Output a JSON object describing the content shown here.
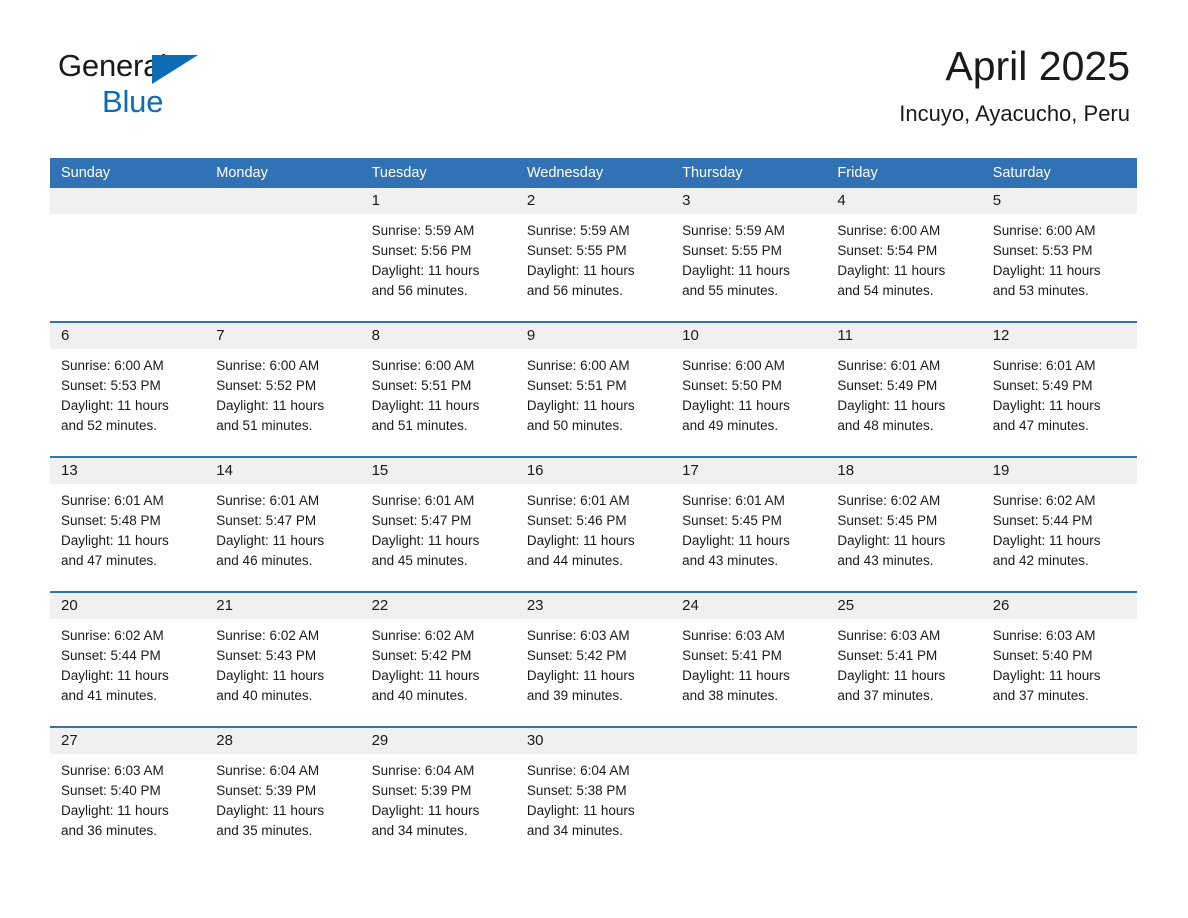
{
  "brand": {
    "name_part_1": "General",
    "name_part_2": "Blue",
    "triangle_color": "#0c6cb5"
  },
  "header": {
    "title": "April 2025",
    "subtitle": "Incuyo, Ayacucho, Peru",
    "accent_color": "#3172b5",
    "daynumber_band_color": "#f0f0f0"
  },
  "weekdays": [
    "Sunday",
    "Monday",
    "Tuesday",
    "Wednesday",
    "Thursday",
    "Friday",
    "Saturday"
  ],
  "weeks": [
    {
      "days": [
        {
          "num": "",
          "sunrise": "",
          "sunset": "",
          "daylight": "",
          "empty": true
        },
        {
          "num": "",
          "sunrise": "",
          "sunset": "",
          "daylight": "",
          "empty": true
        },
        {
          "num": "1",
          "sunrise": "Sunrise: 5:59 AM",
          "sunset": "Sunset: 5:56 PM",
          "daylight": "Daylight: 11 hours and 56 minutes.",
          "empty": false
        },
        {
          "num": "2",
          "sunrise": "Sunrise: 5:59 AM",
          "sunset": "Sunset: 5:55 PM",
          "daylight": "Daylight: 11 hours and 56 minutes.",
          "empty": false
        },
        {
          "num": "3",
          "sunrise": "Sunrise: 5:59 AM",
          "sunset": "Sunset: 5:55 PM",
          "daylight": "Daylight: 11 hours and 55 minutes.",
          "empty": false
        },
        {
          "num": "4",
          "sunrise": "Sunrise: 6:00 AM",
          "sunset": "Sunset: 5:54 PM",
          "daylight": "Daylight: 11 hours and 54 minutes.",
          "empty": false
        },
        {
          "num": "5",
          "sunrise": "Sunrise: 6:00 AM",
          "sunset": "Sunset: 5:53 PM",
          "daylight": "Daylight: 11 hours and 53 minutes.",
          "empty": false
        }
      ]
    },
    {
      "days": [
        {
          "num": "6",
          "sunrise": "Sunrise: 6:00 AM",
          "sunset": "Sunset: 5:53 PM",
          "daylight": "Daylight: 11 hours and 52 minutes.",
          "empty": false
        },
        {
          "num": "7",
          "sunrise": "Sunrise: 6:00 AM",
          "sunset": "Sunset: 5:52 PM",
          "daylight": "Daylight: 11 hours and 51 minutes.",
          "empty": false
        },
        {
          "num": "8",
          "sunrise": "Sunrise: 6:00 AM",
          "sunset": "Sunset: 5:51 PM",
          "daylight": "Daylight: 11 hours and 51 minutes.",
          "empty": false
        },
        {
          "num": "9",
          "sunrise": "Sunrise: 6:00 AM",
          "sunset": "Sunset: 5:51 PM",
          "daylight": "Daylight: 11 hours and 50 minutes.",
          "empty": false
        },
        {
          "num": "10",
          "sunrise": "Sunrise: 6:00 AM",
          "sunset": "Sunset: 5:50 PM",
          "daylight": "Daylight: 11 hours and 49 minutes.",
          "empty": false
        },
        {
          "num": "11",
          "sunrise": "Sunrise: 6:01 AM",
          "sunset": "Sunset: 5:49 PM",
          "daylight": "Daylight: 11 hours and 48 minutes.",
          "empty": false
        },
        {
          "num": "12",
          "sunrise": "Sunrise: 6:01 AM",
          "sunset": "Sunset: 5:49 PM",
          "daylight": "Daylight: 11 hours and 47 minutes.",
          "empty": false
        }
      ]
    },
    {
      "days": [
        {
          "num": "13",
          "sunrise": "Sunrise: 6:01 AM",
          "sunset": "Sunset: 5:48 PM",
          "daylight": "Daylight: 11 hours and 47 minutes.",
          "empty": false
        },
        {
          "num": "14",
          "sunrise": "Sunrise: 6:01 AM",
          "sunset": "Sunset: 5:47 PM",
          "daylight": "Daylight: 11 hours and 46 minutes.",
          "empty": false
        },
        {
          "num": "15",
          "sunrise": "Sunrise: 6:01 AM",
          "sunset": "Sunset: 5:47 PM",
          "daylight": "Daylight: 11 hours and 45 minutes.",
          "empty": false
        },
        {
          "num": "16",
          "sunrise": "Sunrise: 6:01 AM",
          "sunset": "Sunset: 5:46 PM",
          "daylight": "Daylight: 11 hours and 44 minutes.",
          "empty": false
        },
        {
          "num": "17",
          "sunrise": "Sunrise: 6:01 AM",
          "sunset": "Sunset: 5:45 PM",
          "daylight": "Daylight: 11 hours and 43 minutes.",
          "empty": false
        },
        {
          "num": "18",
          "sunrise": "Sunrise: 6:02 AM",
          "sunset": "Sunset: 5:45 PM",
          "daylight": "Daylight: 11 hours and 43 minutes.",
          "empty": false
        },
        {
          "num": "19",
          "sunrise": "Sunrise: 6:02 AM",
          "sunset": "Sunset: 5:44 PM",
          "daylight": "Daylight: 11 hours and 42 minutes.",
          "empty": false
        }
      ]
    },
    {
      "days": [
        {
          "num": "20",
          "sunrise": "Sunrise: 6:02 AM",
          "sunset": "Sunset: 5:44 PM",
          "daylight": "Daylight: 11 hours and 41 minutes.",
          "empty": false
        },
        {
          "num": "21",
          "sunrise": "Sunrise: 6:02 AM",
          "sunset": "Sunset: 5:43 PM",
          "daylight": "Daylight: 11 hours and 40 minutes.",
          "empty": false
        },
        {
          "num": "22",
          "sunrise": "Sunrise: 6:02 AM",
          "sunset": "Sunset: 5:42 PM",
          "daylight": "Daylight: 11 hours and 40 minutes.",
          "empty": false
        },
        {
          "num": "23",
          "sunrise": "Sunrise: 6:03 AM",
          "sunset": "Sunset: 5:42 PM",
          "daylight": "Daylight: 11 hours and 39 minutes.",
          "empty": false
        },
        {
          "num": "24",
          "sunrise": "Sunrise: 6:03 AM",
          "sunset": "Sunset: 5:41 PM",
          "daylight": "Daylight: 11 hours and 38 minutes.",
          "empty": false
        },
        {
          "num": "25",
          "sunrise": "Sunrise: 6:03 AM",
          "sunset": "Sunset: 5:41 PM",
          "daylight": "Daylight: 11 hours and 37 minutes.",
          "empty": false
        },
        {
          "num": "26",
          "sunrise": "Sunrise: 6:03 AM",
          "sunset": "Sunset: 5:40 PM",
          "daylight": "Daylight: 11 hours and 37 minutes.",
          "empty": false
        }
      ]
    },
    {
      "days": [
        {
          "num": "27",
          "sunrise": "Sunrise: 6:03 AM",
          "sunset": "Sunset: 5:40 PM",
          "daylight": "Daylight: 11 hours and 36 minutes.",
          "empty": false
        },
        {
          "num": "28",
          "sunrise": "Sunrise: 6:04 AM",
          "sunset": "Sunset: 5:39 PM",
          "daylight": "Daylight: 11 hours and 35 minutes.",
          "empty": false
        },
        {
          "num": "29",
          "sunrise": "Sunrise: 6:04 AM",
          "sunset": "Sunset: 5:39 PM",
          "daylight": "Daylight: 11 hours and 34 minutes.",
          "empty": false
        },
        {
          "num": "30",
          "sunrise": "Sunrise: 6:04 AM",
          "sunset": "Sunset: 5:38 PM",
          "daylight": "Daylight: 11 hours and 34 minutes.",
          "empty": false
        },
        {
          "num": "",
          "sunrise": "",
          "sunset": "",
          "daylight": "",
          "empty": true
        },
        {
          "num": "",
          "sunrise": "",
          "sunset": "",
          "daylight": "",
          "empty": true
        },
        {
          "num": "",
          "sunrise": "",
          "sunset": "",
          "daylight": "",
          "empty": true
        }
      ]
    }
  ]
}
